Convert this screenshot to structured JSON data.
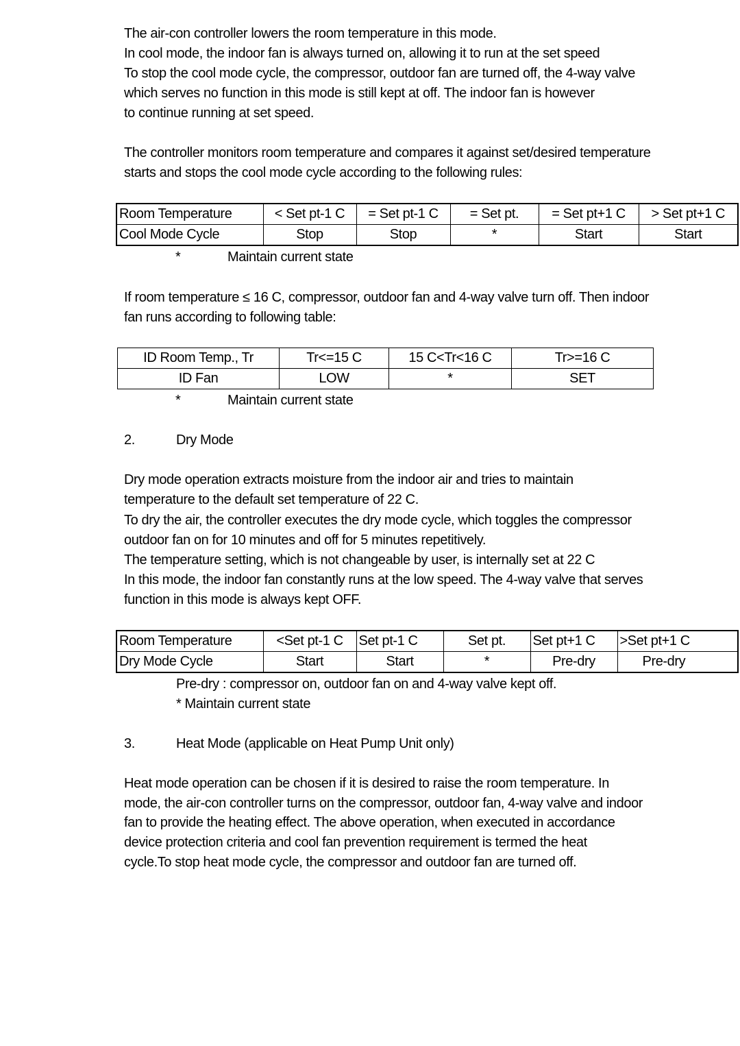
{
  "cool": {
    "p1": [
      "The air-con controller lowers the room temperature in this mode.",
      "In cool mode, the indoor fan is always turned on, allowing it to run at the set speed",
      "To stop the cool mode cycle, the compressor, outdoor fan are turned off, the 4-way valve",
      "which serves no function in this mode is still kept at off.  The indoor fan is however",
      "to continue running at set speed."
    ],
    "p2": [
      "The controller monitors room temperature and compares it against set/desired temperature",
      "starts and stops the cool mode cycle according to the following rules:"
    ],
    "table": {
      "rows": [
        [
          "Room Temperature",
          "< Set pt-1 C",
          "= Set pt-1 C",
          "= Set pt.",
          "= Set pt+1 C",
          "> Set pt+1 C"
        ],
        [
          "Cool Mode Cycle",
          "Stop",
          "Stop",
          "*",
          "Start",
          "Start"
        ]
      ]
    },
    "note_star": "*",
    "note": "Maintain current state",
    "p3": [
      "If room temperature ≤ 16 C, compressor, outdoor fan and 4-way valve turn off. Then indoor",
      "fan runs according to following table:"
    ],
    "fan_table": {
      "rows": [
        [
          "ID Room Temp., Tr",
          "Tr<=15 C",
          "15 C<Tr<16 C",
          "Tr>=16 C"
        ],
        [
          "ID Fan",
          "LOW",
          "*",
          "SET"
        ]
      ]
    },
    "note2_star": "*",
    "note2": "Maintain current state"
  },
  "dry": {
    "num": "2.",
    "title": "Dry Mode",
    "p1": [
      "Dry  mode  operation  extracts  moisture  from  the  indoor  air  and  tries  to  maintain",
      "temperature to the default set temperature of 22 C.",
      "To dry the air, the controller executes the dry mode cycle, which toggles the compressor",
      "outdoor fan on for 10 minutes and off for 5 minutes repetitively.",
      "The temperature setting, which is not changeable by user, is internally set at 22 C",
      "In this mode, the indoor fan constantly runs at the low speed.  The 4-way valve that serves",
      "function in this mode is always kept OFF."
    ],
    "table": {
      "rows": [
        [
          "Room Temperature",
          "<Set pt-1 C",
          "Set pt-1  C",
          "Set pt.",
          "Set pt+1 C",
          ">Set pt+1 C"
        ],
        [
          "Dry Mode Cycle",
          "Start",
          "Start",
          "*",
          "Pre-dry",
          "Pre-dry"
        ]
      ]
    },
    "note1": "Pre-dry : compressor on, outdoor fan on and 4-way valve kept off.",
    "note2": "* Maintain current state"
  },
  "heat": {
    "num": "3.",
    "title": "Heat Mode (applicable on Heat Pump Unit only)",
    "p1": [
      "Heat  mode  operation  can  be  chosen  if  it  is  desired  to  raise  the room temperature.  In",
      "mode,  the  air-con  controller  turns  on  the  compressor,  outdoor  fan, 4-way  valve  and  indoor",
      "fan to provide the heating effect.  The above operation, when executed in accordance",
      "device  protection  criteria  and  cool  fan  prevention requirement  is  termed  the  heat",
      "cycle.To stop heat mode cycle, the compressor and outdoor fan are turned off."
    ]
  }
}
